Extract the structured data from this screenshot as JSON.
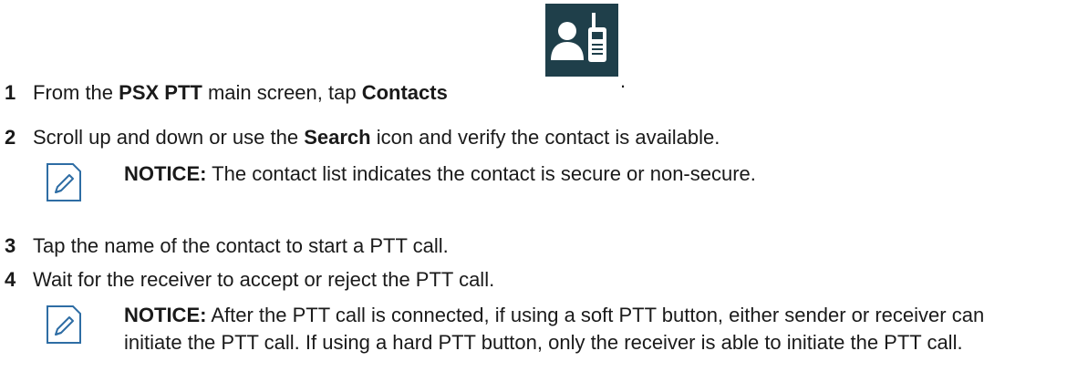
{
  "steps": [
    {
      "number": "1",
      "text_1": "From the ",
      "bold_1": "PSX PTT",
      "text_2": " main screen, tap ",
      "bold_2": "Contacts"
    },
    {
      "number": "2",
      "text_1": "Scroll up and down or use the ",
      "bold_1": "Search",
      "text_2": " icon and verify the contact is available."
    },
    {
      "number": "3",
      "text": "Tap the name of the contact to start a PTT call."
    },
    {
      "number": "4",
      "text": "Wait for the receiver to accept or reject the PTT call."
    }
  ],
  "period": ".",
  "notices": [
    {
      "label": "NOTICE:",
      "text": " The contact list indicates the contact is secure or non-secure."
    },
    {
      "label": "NOTICE:",
      "text": " After the PTT call is connected, if using a soft PTT button, either sender or receiver can initiate the PTT call. If using a hard PTT button, only the receiver is able to initiate the PTT call."
    }
  ],
  "icons": {
    "contacts": "contacts-radio-icon",
    "notice": "notice-pencil-icon"
  },
  "colors": {
    "contacts_icon_bg": "#1f3f4a",
    "notice_icon": "#2e6da4"
  }
}
